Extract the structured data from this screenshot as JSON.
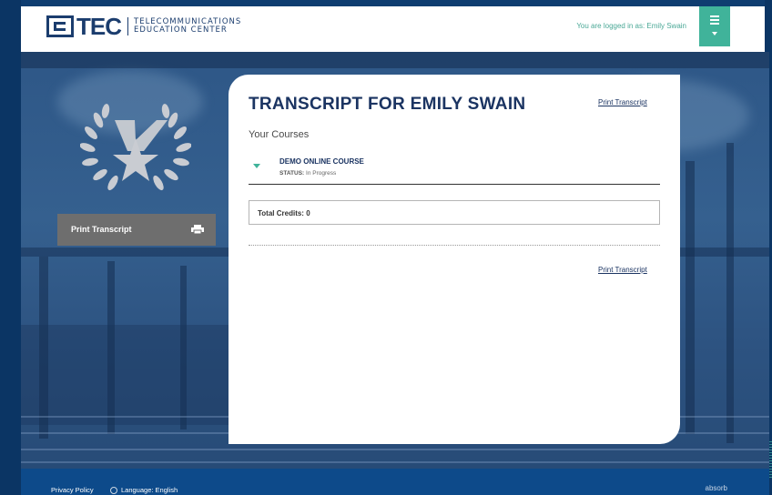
{
  "header": {
    "logo_word": "TEC",
    "logo_sub_line1": "TELECOMMUNICATIONS",
    "logo_sub_line2": "EDUCATION CENTER",
    "logged_in_text": "You are logged in as: Emily Swain"
  },
  "sidebar": {
    "print_button_label": "Print Transcript"
  },
  "transcript": {
    "title": "TRANSCRIPT FOR EMILY SWAIN",
    "print_link_top": "Print Transcript",
    "print_link_bottom": "Print Transcript",
    "section_heading": "Your Courses",
    "courses": [
      {
        "name": "DEMO ONLINE COURSE",
        "status_label": "STATUS:",
        "status_value": "In Progress"
      }
    ],
    "total_credits": "Total Credits: 0"
  },
  "footer": {
    "privacy": "Privacy Policy",
    "language": "Language: English",
    "brand": "absorb"
  },
  "colors": {
    "navy": "#1b3462",
    "accent_teal": "#40b39a",
    "footer_blue": "#0d4a8a",
    "button_gray": "#6e6e6e"
  },
  "icons": [
    "menu-list-icon",
    "laurel-wreath-star-icon",
    "printer-icon",
    "expand-caret-icon",
    "globe-icon"
  ]
}
